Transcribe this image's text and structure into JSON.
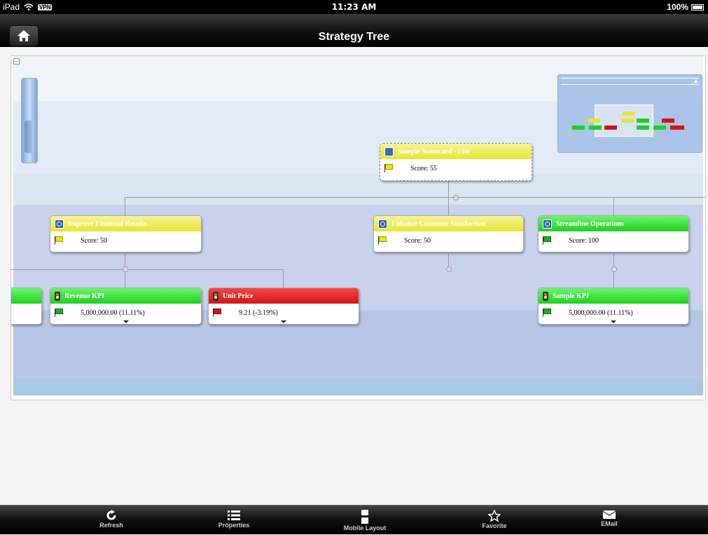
{
  "status_bar": {
    "device": "iPad",
    "vpn": "VPN",
    "time": "11:23 AM",
    "battery": "100%"
  },
  "nav": {
    "title": "Strategy Tree"
  },
  "tree": {
    "root": {
      "title": "Sample Scorecard - Lite",
      "score": "Score: 55",
      "status": "yellow"
    },
    "objectives": [
      {
        "title": "Improve Financial Results",
        "score": "Score: 50",
        "status": "yellow"
      },
      {
        "title": "Enhance Customer Satisfaction",
        "score": "Score: 50",
        "status": "yellow"
      },
      {
        "title": "Streamline Operations",
        "score": "Score: 100",
        "status": "green"
      }
    ],
    "kpis": [
      {
        "title": "Revenue KPI",
        "value": "5,000,000.00 (11.11%)",
        "status": "green"
      },
      {
        "title": "Unit Price",
        "value": "9.21 (-3.19%)",
        "status": "red"
      },
      {
        "title": "Sample KPI",
        "value": "5,000,000.00 (11.11%)",
        "status": "green"
      }
    ]
  },
  "toolbar": {
    "items": [
      {
        "label": "Refresh",
        "icon": "refresh-icon"
      },
      {
        "label": "Properties",
        "icon": "list-icon"
      },
      {
        "label": "Mobile Layout",
        "icon": "layout-icon"
      },
      {
        "label": "Favorite",
        "icon": "star-icon"
      },
      {
        "label": "EMail",
        "icon": "envelope-icon"
      }
    ]
  },
  "colors": {
    "yellow": "#e6e632",
    "green": "#20d020",
    "red": "#d41414",
    "canvas_band": "#b9c8e6"
  }
}
